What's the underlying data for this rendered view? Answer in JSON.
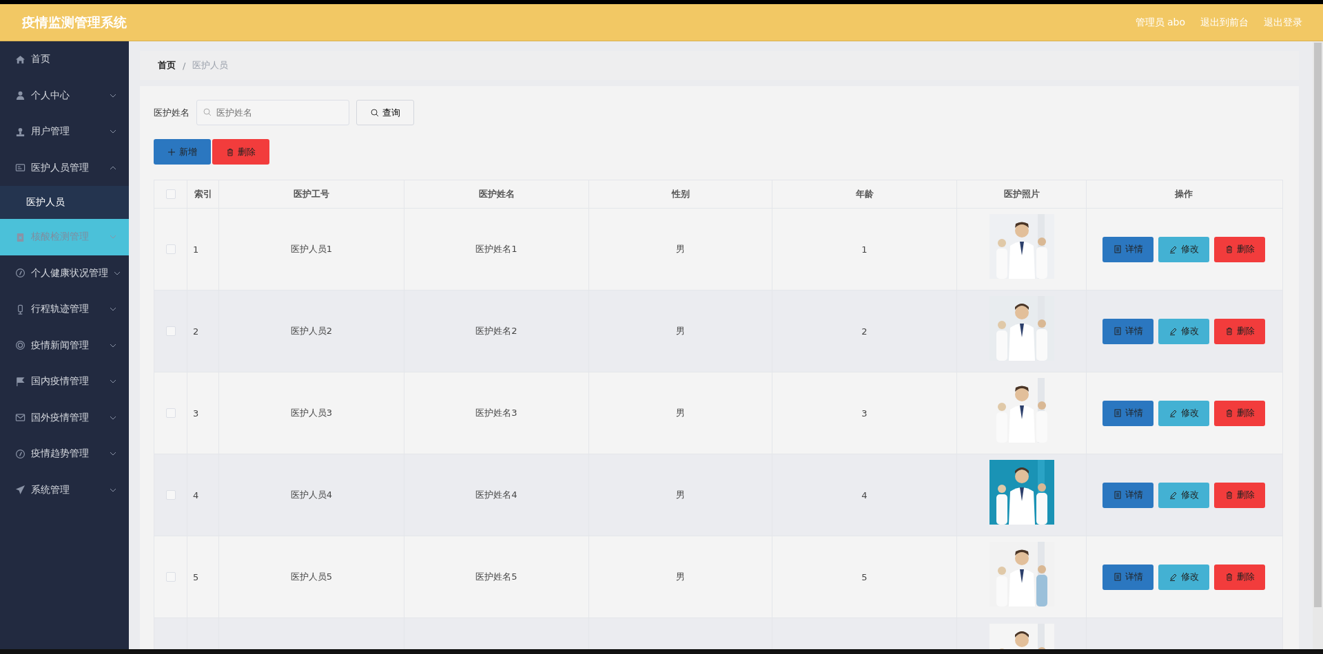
{
  "header": {
    "title": "疫情监测管理系统",
    "links": [
      "管理员 abo",
      "退出到前台",
      "退出登录"
    ]
  },
  "sidebar": {
    "items": [
      {
        "kind": "link",
        "label": "首页",
        "selected": false
      },
      {
        "kind": "submenu",
        "label": "个人中心",
        "expanded": false,
        "selected": false
      },
      {
        "kind": "submenu",
        "label": "用户管理",
        "expanded": false,
        "selected": false
      },
      {
        "kind": "submenu",
        "label": "医护人员管理",
        "expanded": true,
        "selected": false,
        "children": [
          {
            "label": "医护人员",
            "selected": true
          }
        ]
      },
      {
        "kind": "submenu",
        "label": "核酸检测管理",
        "expanded": false,
        "selected": true
      },
      {
        "kind": "submenu",
        "label": "个人健康状况管理",
        "expanded": false,
        "selected": false
      },
      {
        "kind": "submenu",
        "label": "行程轨迹管理",
        "expanded": false,
        "selected": false
      },
      {
        "kind": "submenu",
        "label": "疫情新闻管理",
        "expanded": false,
        "selected": false
      },
      {
        "kind": "submenu",
        "label": "国内疫情管理",
        "expanded": false,
        "selected": false
      },
      {
        "kind": "submenu",
        "label": "国外疫情管理",
        "expanded": false,
        "selected": false
      },
      {
        "kind": "submenu",
        "label": "疫情趋势管理",
        "expanded": false,
        "selected": false
      },
      {
        "kind": "submenu",
        "label": "系统管理",
        "expanded": false,
        "selected": false
      }
    ]
  },
  "breadcrumb": {
    "items": [
      "首页",
      "医护人员"
    ],
    "separator": "/"
  },
  "search": {
    "label": "医护姓名",
    "placeholder": "医护姓名",
    "button": "查询"
  },
  "actions": {
    "add": "新增",
    "delete": "删除"
  },
  "table": {
    "select_all_checked": false,
    "columns": [
      "索引",
      "医护工号",
      "医护姓名",
      "性别",
      "年龄",
      "医护照片",
      "操作"
    ],
    "rows": [
      {
        "checked": false,
        "index": "1",
        "id": "医护人员1",
        "name": "医护姓名1",
        "gender": "男",
        "age": "1",
        "photo": {
          "kind": "picture"
        },
        "buttons": [
          "详情",
          "修改",
          "删除"
        ]
      },
      {
        "checked": false,
        "index": "2",
        "id": "医护人员2",
        "name": "医护姓名2",
        "gender": "男",
        "age": "2",
        "photo": {
          "kind": "picture"
        },
        "buttons": [
          "详情",
          "修改",
          "删除"
        ]
      },
      {
        "checked": false,
        "index": "3",
        "id": "医护人员3",
        "name": "医护姓名3",
        "gender": "男",
        "age": "3",
        "photo": {
          "kind": "picture"
        },
        "buttons": [
          "详情",
          "修改",
          "删除"
        ]
      },
      {
        "checked": false,
        "index": "4",
        "id": "医护人员4",
        "name": "医护姓名4",
        "gender": "男",
        "age": "4",
        "photo": {
          "kind": "picture"
        },
        "buttons": [
          "详情",
          "修改",
          "删除"
        ]
      },
      {
        "checked": false,
        "index": "5",
        "id": "医护人员5",
        "name": "医护姓名5",
        "gender": "男",
        "age": "5",
        "photo": {
          "kind": "picture"
        },
        "buttons": [
          "详情",
          "修改",
          "删除"
        ]
      },
      {
        "photo": {
          "kind": "picture"
        }
      }
    ]
  }
}
